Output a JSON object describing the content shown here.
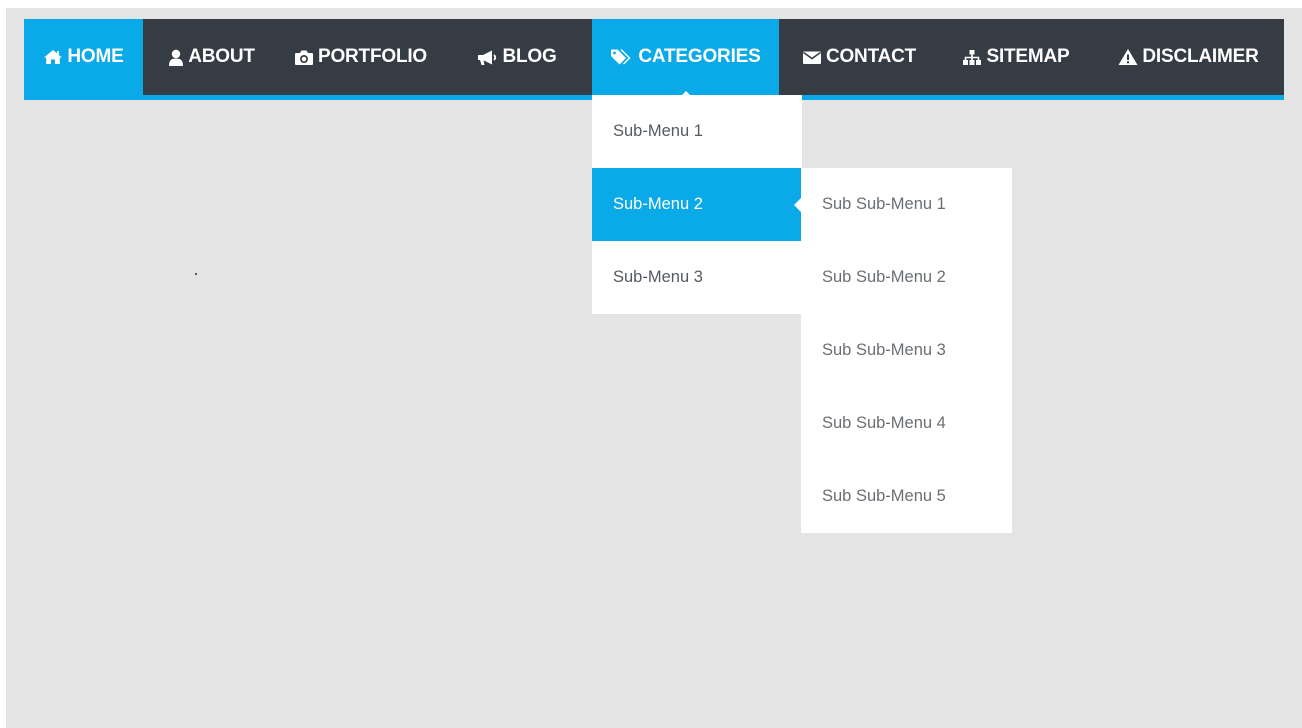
{
  "nav": {
    "items": [
      {
        "label": "HOME",
        "icon": "home-icon",
        "active": true
      },
      {
        "label": "ABOUT",
        "icon": "user-icon",
        "active": false
      },
      {
        "label": "PORTFOLIO",
        "icon": "camera-icon",
        "active": false
      },
      {
        "label": "BLOG",
        "icon": "megaphone-icon",
        "active": false
      },
      {
        "label": "CATEGORIES",
        "icon": "tags-icon",
        "active": true
      },
      {
        "label": "CONTACT",
        "icon": "envelope-icon",
        "active": false
      },
      {
        "label": "SITEMAP",
        "icon": "sitemap-icon",
        "active": false
      },
      {
        "label": "DISCLAIMER",
        "icon": "warning-icon",
        "active": false
      }
    ]
  },
  "submenu": {
    "items": [
      {
        "label": "Sub-Menu 1",
        "active": false
      },
      {
        "label": "Sub-Menu 2",
        "active": true
      },
      {
        "label": "Sub-Menu 3",
        "active": false
      }
    ]
  },
  "subsubmenu": {
    "items": [
      {
        "label": "Sub Sub-Menu 1"
      },
      {
        "label": "Sub Sub-Menu 2"
      },
      {
        "label": "Sub Sub-Menu 3"
      },
      {
        "label": "Sub Sub-Menu 4"
      },
      {
        "label": "Sub Sub-Menu 5"
      }
    ]
  },
  "colors": {
    "accent": "#0aaae8",
    "nav_bg": "#363c44",
    "page_bg": "#e4e4e4",
    "menu_text": "#555a60"
  }
}
